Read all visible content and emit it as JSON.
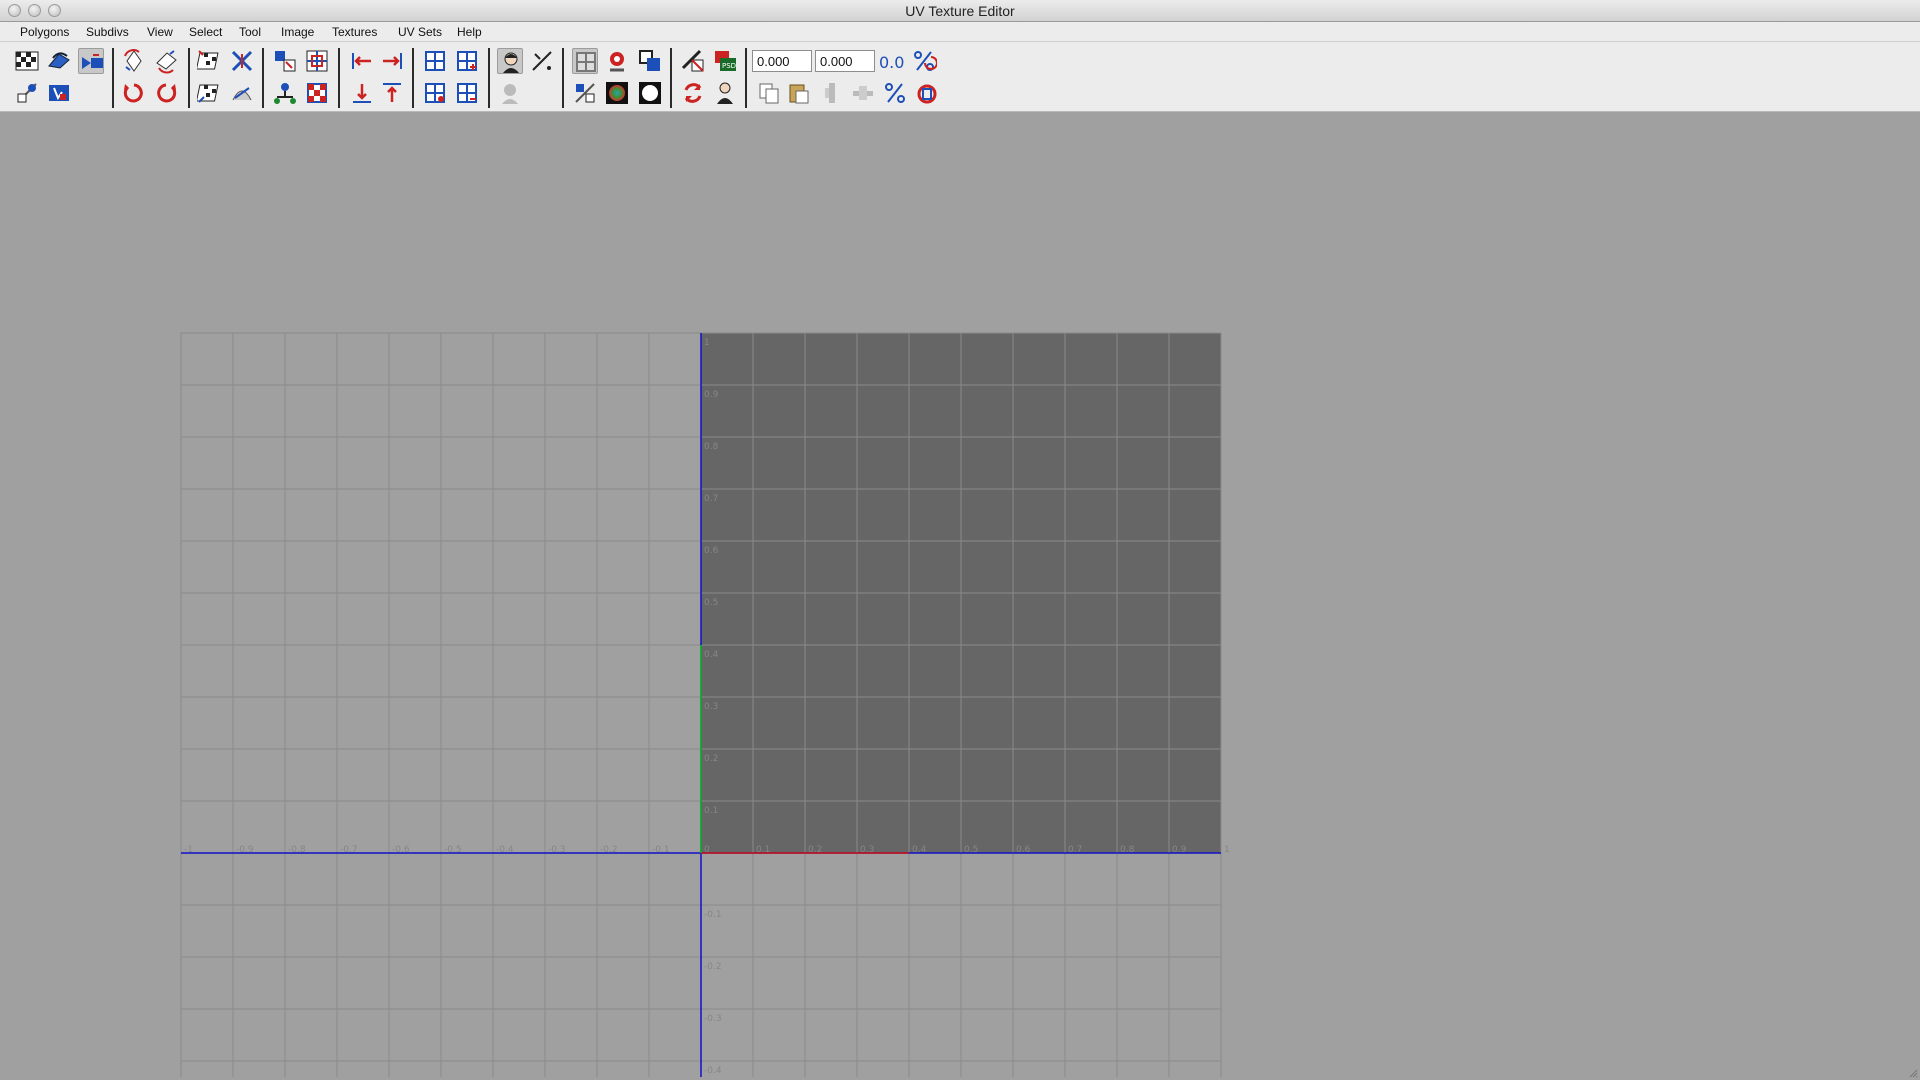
{
  "window": {
    "title": "UV Texture Editor"
  },
  "menu": [
    "Polygons",
    "Subdivs",
    "View",
    "Select",
    "Tool",
    "Image",
    "Textures",
    "UV Sets",
    "Help"
  ],
  "toolbar": {
    "u_value": "0.000",
    "v_value": "0.000",
    "row1_icons": [
      "checker-map-icon",
      "uv-flip-icon",
      "uv-project-icon",
      "rotate-ccw-uv-icon",
      "rotate-cw-uv-icon",
      "unfold-checker-icon",
      "cut-uv-icon",
      "move-sew-icon",
      "layout-uv-icon",
      "arrow-left-icon",
      "arrow-right-icon",
      "grid-layout-icon",
      "grid-add-icon",
      "face-icon",
      "pin-icon",
      "grid-toggle-icon",
      "snap-icon",
      "overlap-icon",
      "image-settings-icon",
      "psd-icon",
      "zero-zero-icon",
      "percent-icon"
    ],
    "row2_icons": [
      "smooth-uv-icon",
      "uv-shell-icon",
      "rotate-left-icon",
      "rotate-right-icon",
      "unfold-icon",
      "relax-icon",
      "straighten-icon",
      "grid-checker-icon",
      "arrow-down-icon",
      "arrow-up-icon",
      "grid-remove-icon",
      "grid-minus-icon",
      "shaded-face-icon",
      "shade-toggle-icon",
      "color-ball-icon",
      "white-ball-icon",
      "refresh-icon",
      "person-icon",
      "copy-icon",
      "paste-icon",
      "align-vertical-icon",
      "align-horizontal-icon",
      "percent-toggle-icon",
      "undo-ring-icon"
    ]
  },
  "grid": {
    "u_labels": [
      "-1",
      "-0.9",
      "-0.8",
      "-0.7",
      "-0.6",
      "-0.5",
      "-0.4",
      "-0.3",
      "-0.2",
      "-0.1",
      "0",
      "0.1",
      "0.2",
      "0.3",
      "0.4",
      "0.5",
      "0.6",
      "0.7",
      "0.8",
      "0.9",
      "1"
    ],
    "v_labels": [
      "1",
      "0.9",
      "0.8",
      "0.7",
      "0.6",
      "0.5",
      "0.4",
      "0.3",
      "0.2",
      "0.1",
      "-0.1",
      "-0.2",
      "-0.3",
      "-0.4"
    ],
    "colors": {
      "axis": "#1010c8",
      "u_axis_highlight": "#d01010",
      "v_axis_highlight": "#10c010",
      "texture_area": "#666666",
      "gridline": "#8a8a8a"
    }
  }
}
